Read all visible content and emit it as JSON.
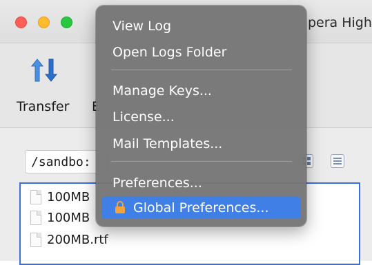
{
  "window": {
    "title": "pera High"
  },
  "toolbar": {
    "transfer_label": "Transfer",
    "next_label_partial": "E"
  },
  "path": {
    "value": "/sandbo:"
  },
  "files": [
    {
      "name": "100MB"
    },
    {
      "name": "100MB"
    },
    {
      "name": "200MB.rtf"
    }
  ],
  "menu": {
    "items": [
      {
        "label": "View Log"
      },
      {
        "label": "Open Logs Folder"
      },
      {
        "label": "Manage Keys..."
      },
      {
        "label": "License..."
      },
      {
        "label": "Mail Templates..."
      },
      {
        "label": "Preferences..."
      },
      {
        "label": "Global Preferences...",
        "icon": "lock-icon",
        "highlighted": true
      }
    ]
  },
  "colors": {
    "menu_background": "#767676",
    "highlight": "#3f7fe6",
    "selection_border": "#3a6fe0"
  }
}
